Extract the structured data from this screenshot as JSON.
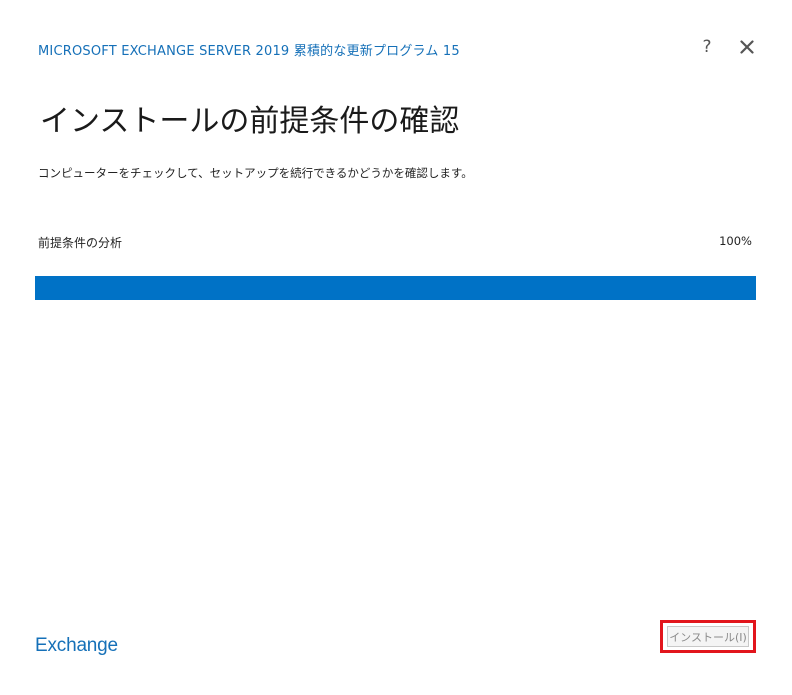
{
  "header": {
    "app_title": "MICROSOFT EXCHANGE SERVER 2019 累積的な更新プログラム 15",
    "help_label": "?",
    "accent_color": "#1570b8"
  },
  "main": {
    "page_title": "インストールの前提条件の確認",
    "description": "コンピューターをチェックして、セットアップを続行できるかどうかを確認します。",
    "progress": {
      "label": "前提条件の分析",
      "percent_text": "100%",
      "value": 100,
      "fill_color": "#0072c6"
    }
  },
  "footer": {
    "brand": "Exchange",
    "install_label": "インストール(I)",
    "install_enabled": false,
    "highlight_color": "#e2151c"
  },
  "icons": {
    "help": "question-mark-icon",
    "close": "close-x-icon"
  }
}
